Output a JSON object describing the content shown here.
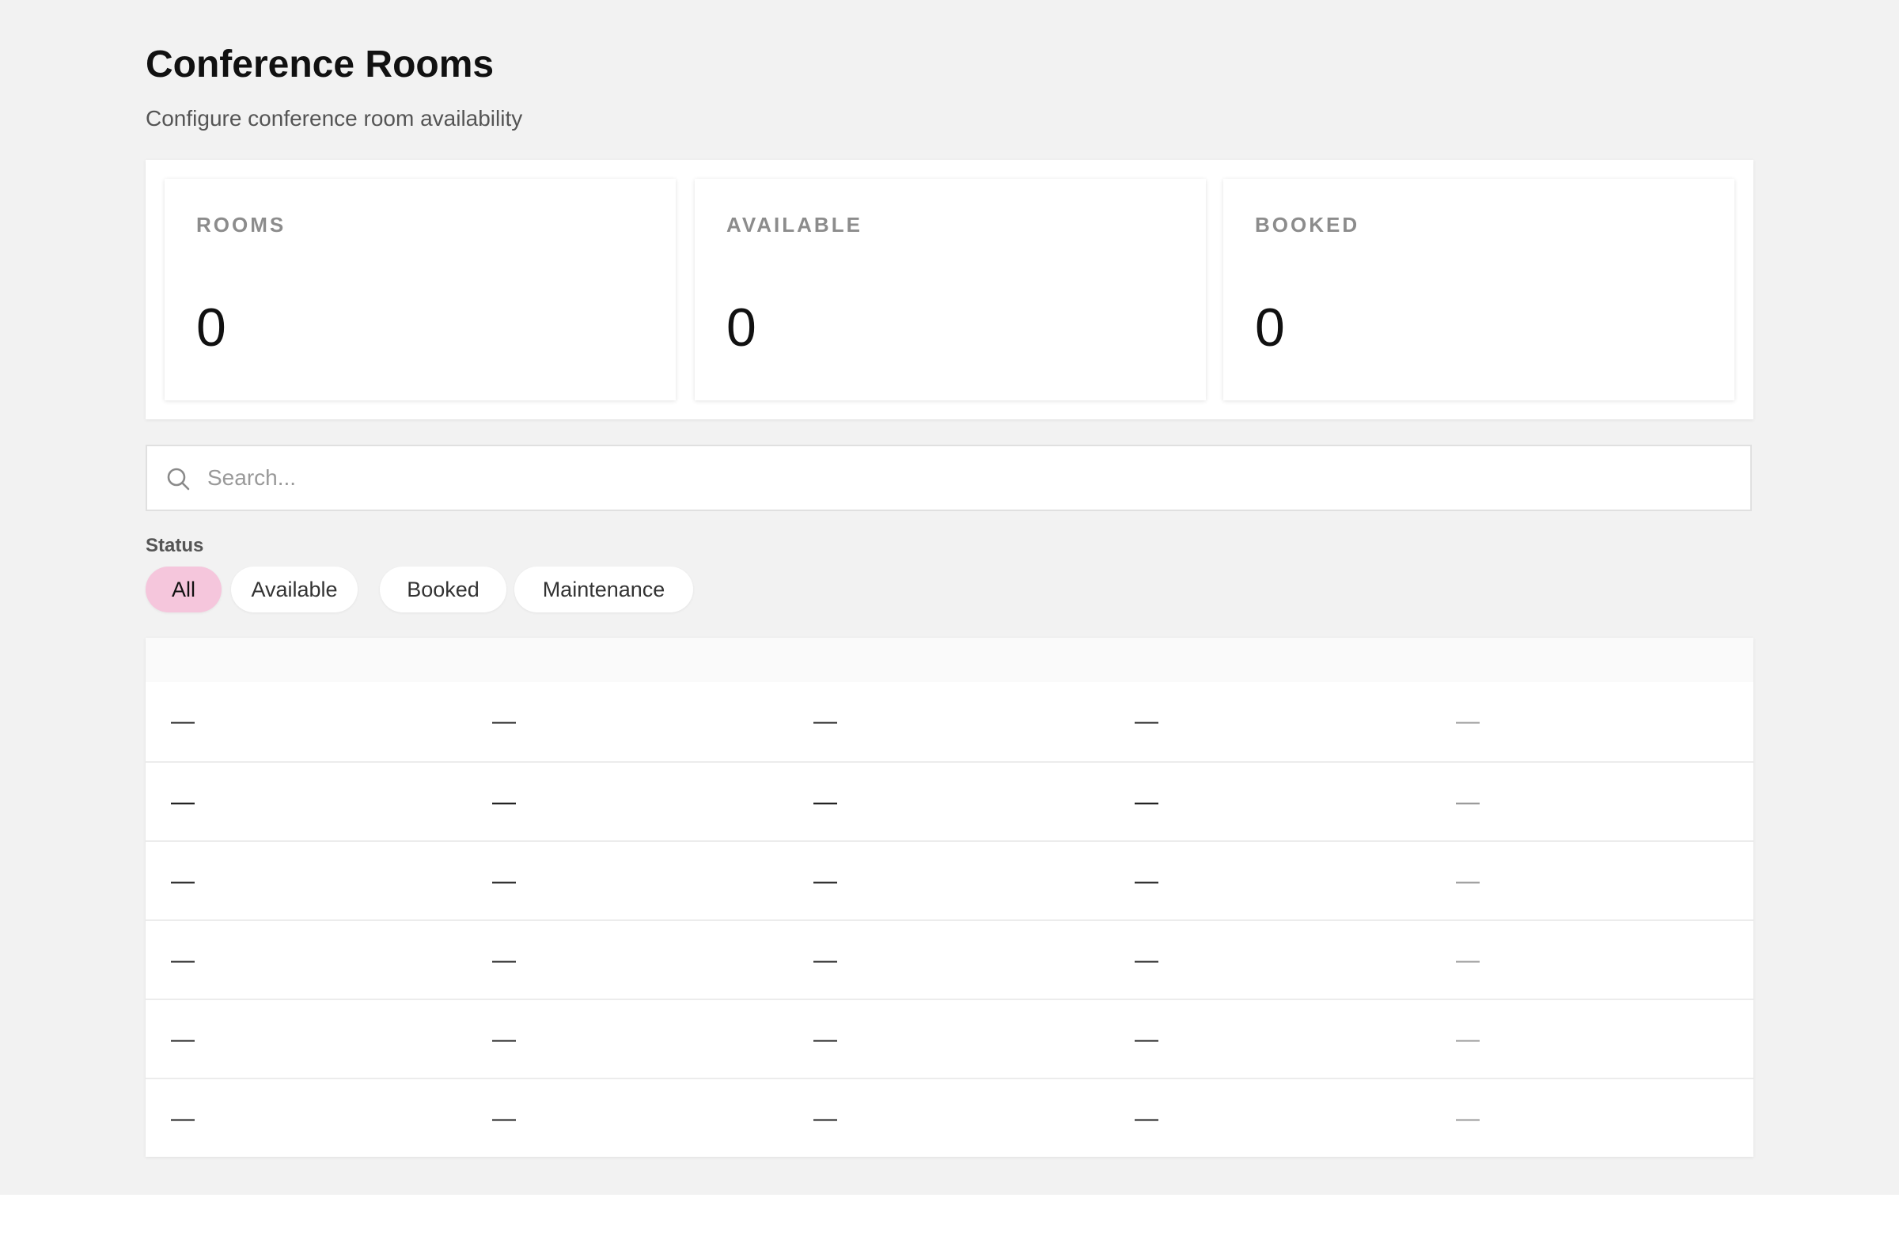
{
  "page": {
    "title": "Conference Rooms",
    "subtitle": "Configure conference room availability"
  },
  "stats": [
    {
      "label": "ROOMS",
      "value": "0"
    },
    {
      "label": "AVAILABLE",
      "value": "0"
    },
    {
      "label": "BOOKED",
      "value": "0"
    }
  ],
  "search": {
    "placeholder": "Search...",
    "value": ""
  },
  "filters": {
    "label": "Status",
    "options": [
      "All",
      "Available",
      "Booked",
      "Maintenance"
    ],
    "selected": "All"
  },
  "table": {
    "rows": [
      [
        "—",
        "—",
        "—",
        "—",
        "—"
      ],
      [
        "—",
        "—",
        "—",
        "—",
        "—"
      ],
      [
        "—",
        "—",
        "—",
        "—",
        "—"
      ],
      [
        "—",
        "—",
        "—",
        "—",
        "—"
      ],
      [
        "—",
        "—",
        "—",
        "—",
        "—"
      ],
      [
        "—",
        "—",
        "—",
        "—",
        "—"
      ]
    ]
  },
  "colors": {
    "background": "#f2f2f2",
    "active_pill": "#f5c6dc",
    "muted_label": "#8c8c8c"
  },
  "icons": {
    "search": "search-icon"
  }
}
